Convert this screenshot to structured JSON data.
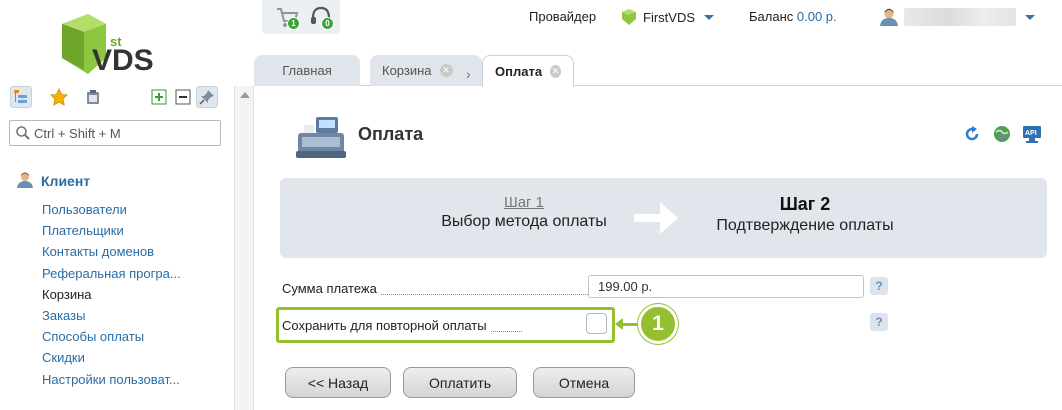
{
  "logo": {
    "text_main": "VDS",
    "text_super": "st"
  },
  "sidebar": {
    "search_placeholder": "Ctrl + Shift + M",
    "section_title": "Клиент",
    "items": [
      {
        "label": "Пользователи"
      },
      {
        "label": "Плательщики"
      },
      {
        "label": "Контакты доменов"
      },
      {
        "label": "Реферальная програ..."
      },
      {
        "label": "Корзина"
      },
      {
        "label": "Заказы"
      },
      {
        "label": "Способы оплаты"
      },
      {
        "label": "Скидки"
      },
      {
        "label": "Настройки пользоват..."
      }
    ],
    "current_item": "Корзина"
  },
  "topbar": {
    "cart_badge": "1",
    "support_badge": "0",
    "provider_label": "Провайдер",
    "provider_value": "FirstVDS",
    "balance_label": "Баланс",
    "balance_value": "0.00 р."
  },
  "tabs": [
    {
      "label": "Главная",
      "closable": false
    },
    {
      "label": "Корзина",
      "closable": true
    },
    {
      "label": "Оплата",
      "closable": true,
      "active": true
    }
  ],
  "page": {
    "title": "Оплата",
    "wizard": {
      "step1_title": "Шаг 1",
      "step1_sub": "Выбор метода оплаты",
      "step2_title": "Шаг 2",
      "step2_sub": "Подтверждение оплаты"
    },
    "form": {
      "amount_label": "Сумма платежа",
      "amount_value": "199.00 р.",
      "save_label": "Сохранить для повторной оплаты",
      "save_checked": false,
      "help_text": "?"
    },
    "callout_number": "1",
    "buttons": {
      "back": "<< Назад",
      "pay": "Оплатить",
      "cancel": "Отмена"
    }
  },
  "colors": {
    "accent_green": "#94bf2e",
    "link_blue": "#2b6ca4",
    "wizard_bg": "#e1e6ec"
  }
}
